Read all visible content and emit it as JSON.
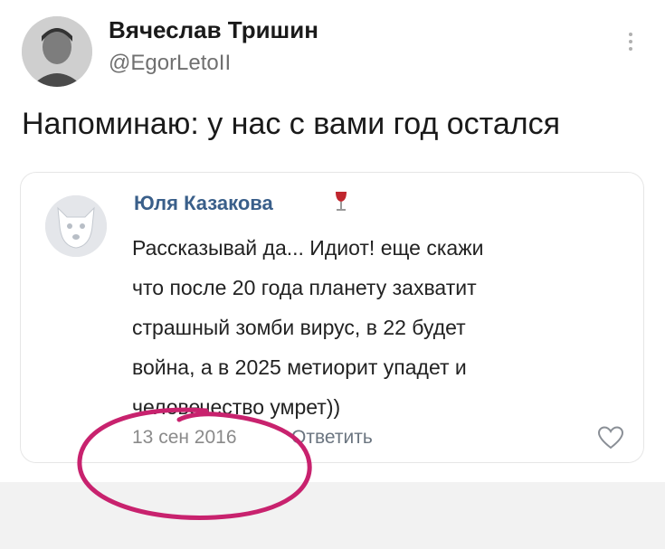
{
  "tweet": {
    "author_name": "Вячеслав Тришин",
    "author_handle": "@EgorLetoII",
    "text": "Напоминаю: у нас с вами год остался"
  },
  "comment": {
    "author_name": "Юля Казакова",
    "text_lines": [
      "Рассказывай да... Идиот! еще скажи",
      "что после 20 года планету захватит",
      "страшный зомби вирус, в 22 будет",
      "война, а в 2025 метиорит упадет и",
      "человечество умрет))"
    ],
    "date": "13 сен 2016",
    "reply_label": "Ответить"
  },
  "icons": {
    "more": "more-vertical-icon",
    "wine": "wine-glass-icon",
    "heart": "heart-outline-icon",
    "annotation_color": "#c8226e"
  }
}
